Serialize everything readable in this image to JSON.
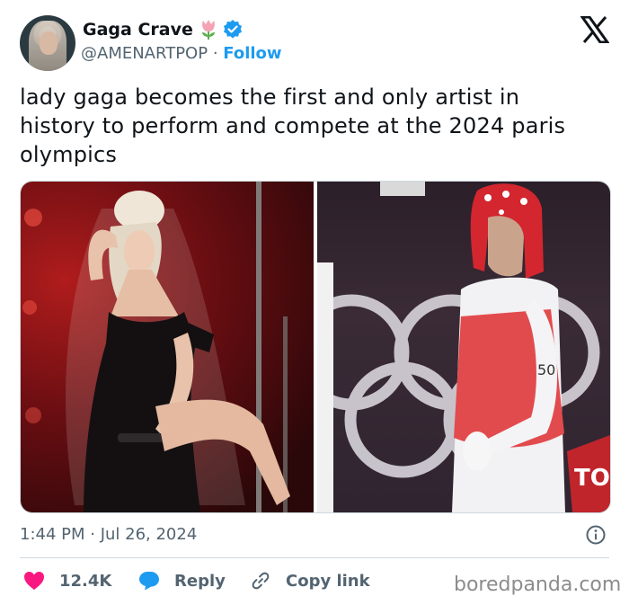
{
  "header": {
    "name": "Gaga Crave",
    "handle": "@AMENARTPOP",
    "separator": "·",
    "follow_label": "Follow"
  },
  "tweet": {
    "text_line1": "lady gaga becomes the first and only artist in",
    "text_line2": "history to perform and compete at the 2024 paris",
    "text_line3": "olympics",
    "timestamp": "1:44 PM · Jul 26, 2024"
  },
  "media": {
    "right_tunic_number": "50",
    "right_board_text": "TO"
  },
  "actions": {
    "like_count": "12.4K",
    "reply_label": "Reply",
    "copy_label": "Copy link"
  },
  "watermark": "boredpanda.com",
  "colors": {
    "accent_blue": "#1d9bf0",
    "like_red": "#f91880",
    "secondary_text": "#536471",
    "divider": "#cfd9de"
  },
  "icons": [
    "tulip-emoji-icon",
    "verified-badge-icon",
    "x-logo-icon",
    "info-icon",
    "heart-icon",
    "reply-bubble-icon",
    "link-icon"
  ]
}
